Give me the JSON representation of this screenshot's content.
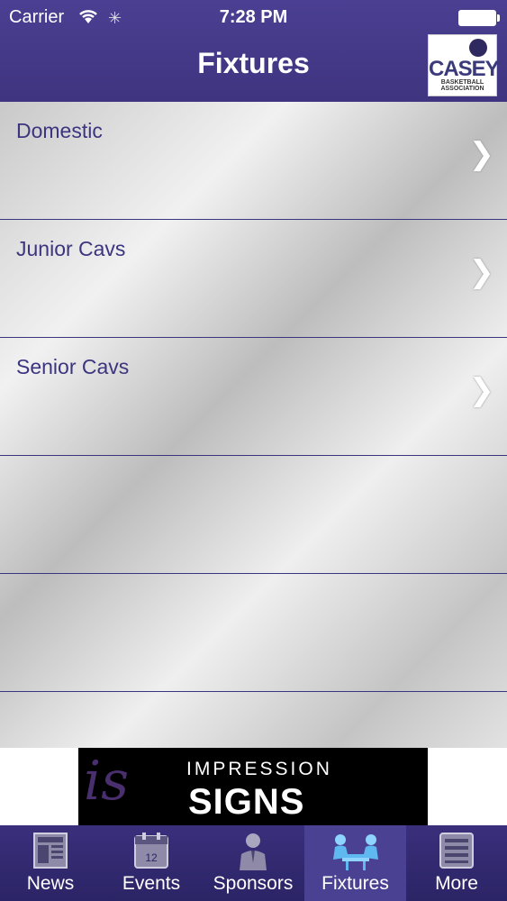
{
  "status": {
    "carrier": "Carrier",
    "time": "7:28 PM"
  },
  "header": {
    "title": "Fixtures",
    "logo": {
      "word": "CASEY",
      "sub": "BASKETBALL ASSOCIATION"
    }
  },
  "list": {
    "items": [
      {
        "label": "Domestic"
      },
      {
        "label": "Junior Cavs"
      },
      {
        "label": "Senior Cavs"
      },
      {
        "label": ""
      },
      {
        "label": ""
      }
    ]
  },
  "banner": {
    "script": "is",
    "line1": "IMPRESSION",
    "line2": "SIGNS"
  },
  "tabs": [
    {
      "label": "News",
      "icon": "news-icon"
    },
    {
      "label": "Events",
      "icon": "calendar-icon",
      "badge": "12"
    },
    {
      "label": "Sponsors",
      "icon": "person-icon"
    },
    {
      "label": "Fixtures",
      "icon": "meeting-icon",
      "active": true
    },
    {
      "label": "More",
      "icon": "list-icon"
    }
  ],
  "colors": {
    "header": "#4a3f92",
    "accent": "#3b3580",
    "tabbar": "#2b2465"
  }
}
